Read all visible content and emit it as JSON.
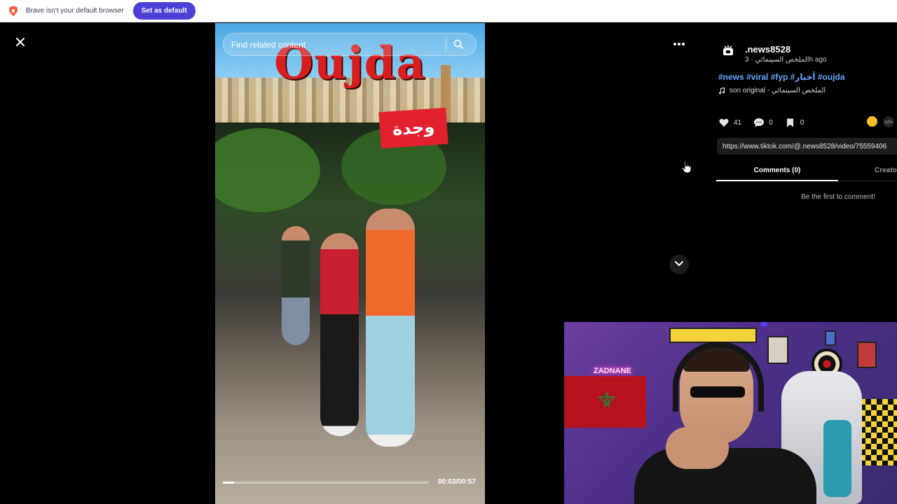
{
  "infobar": {
    "message": "Brave isn't your default browser",
    "set_default_label": "Set as default"
  },
  "player": {
    "search_placeholder": "Find related content",
    "video_title_overlay": "Oujda",
    "video_badge_text": "وجدة",
    "progress_fraction": 0.053,
    "time_display": "00:03/00:57"
  },
  "post": {
    "username": ".news8528",
    "subline": "الملخص السينمائي · 3h ago",
    "hashtags": "#news #viral #fyp #أخبار #oujda",
    "sound": "son original - الملخص السينمائي",
    "stats": {
      "likes": "41",
      "comments": "0",
      "saves": "0"
    },
    "link": "https://www.tiktok.com/@.news8528/video/75559406",
    "tabs": {
      "comments": "Comments (0)",
      "creator": "Creator videos"
    },
    "empty_comments": "Be the first to comment!"
  },
  "webcam": {
    "neon_sign": "ZADNANE"
  },
  "colors": {
    "brand_accent": "#4c3fd6",
    "hashtag": "#6aa8ff",
    "title_red": "#d81e1e",
    "badge_red": "#e2202e",
    "coin": "#f2c02a"
  },
  "icons": {
    "brave": "brave-lion-icon",
    "close": "close-icon",
    "more": "more-dots-icon",
    "down": "chevron-down-icon",
    "search": "search-icon",
    "note": "music-note-icon",
    "heart": "heart-icon",
    "comment": "comment-icon",
    "bookmark": "bookmark-icon",
    "embed": "code-icon",
    "avatar": "tiktok-avatar-icon"
  }
}
